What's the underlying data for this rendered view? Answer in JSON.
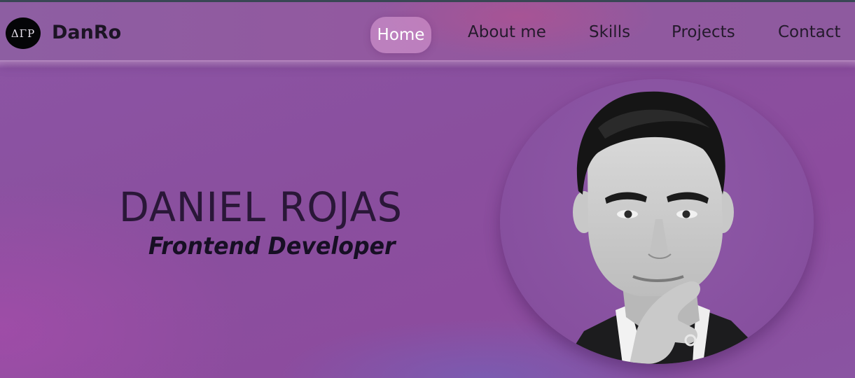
{
  "header": {
    "logo_text": "ΔΓΡ",
    "brand": "DanRo",
    "nav": [
      {
        "label": "Home",
        "active": true
      },
      {
        "label": "About me",
        "active": false
      },
      {
        "label": "Skills",
        "active": false
      },
      {
        "label": "Projects",
        "active": false
      },
      {
        "label": "Contact",
        "active": false
      }
    ]
  },
  "hero": {
    "name": "DANIEL ROJAS",
    "role": "Frontend Developer",
    "photo_icon": "profile-photo"
  },
  "colors": {
    "background": "#8c4f9f",
    "nav_active": "#dea0d7",
    "name_text": "#2a1738",
    "role_text": "#170f24"
  }
}
